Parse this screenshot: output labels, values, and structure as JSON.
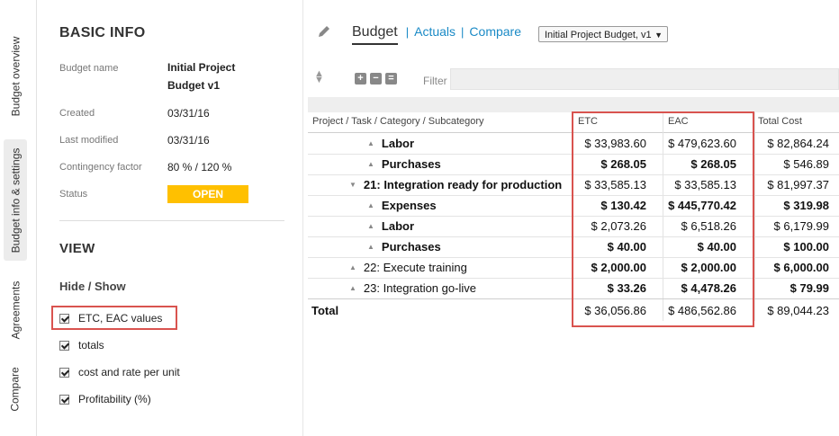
{
  "vertical_tabs": [
    {
      "label": "Budget overview"
    },
    {
      "label": "Budget info & settings"
    },
    {
      "label": "Agreements"
    },
    {
      "label": "Compare"
    }
  ],
  "basic_info": {
    "title": "BASIC INFO",
    "budget_name_label": "Budget name",
    "budget_name_line1": "Initial Project",
    "budget_name_line2": "Budget v1",
    "created_label": "Created",
    "created_value": "03/31/16",
    "modified_label": "Last modified",
    "modified_value": "03/31/16",
    "contingency_label": "Contingency factor",
    "contingency_value": "80 % / 120 %",
    "status_label": "Status",
    "status_value": "OPEN",
    "status_color": "#ffc000"
  },
  "view": {
    "title": "VIEW",
    "hide_show_label": "Hide / Show",
    "options": [
      {
        "label": "ETC, EAC values",
        "checked": true
      },
      {
        "label": "totals",
        "checked": true
      },
      {
        "label": "cost and rate per unit",
        "checked": true
      },
      {
        "label": "Profitability (%)",
        "checked": true
      }
    ]
  },
  "tabs": {
    "budget": "Budget",
    "actuals": "Actuals",
    "compare": "Compare",
    "separator": "|"
  },
  "version_select": "Initial Project Budget, v1",
  "toolbar": {
    "filter_label": "Filter",
    "expand_glyph": "+",
    "collapse_glyph": "−",
    "collapse_all_glyph": "="
  },
  "table": {
    "headers": {
      "name": "Project / Task / Category / Subcategory",
      "etc": "ETC",
      "eac": "EAC",
      "total": "Total Cost"
    },
    "rows": [
      {
        "name": "Labor",
        "tri": "▲",
        "etc": "$ 33,983.60",
        "eac": "$ 479,623.60",
        "total": "$ 82,864.24"
      },
      {
        "name": "Purchases",
        "tri": "▲",
        "etc": "$ 268.05",
        "eac": "$ 268.05",
        "total": "$ 546.89"
      },
      {
        "name": "21: Integration ready for production",
        "tri": "▼",
        "etc": "$ 33,585.13",
        "eac": "$ 33,585.13",
        "total": "$ 81,997.37"
      },
      {
        "name": "Expenses",
        "tri": "▲",
        "etc": "$ 130.42",
        "eac": "$ 445,770.42",
        "total": "$ 319.98"
      },
      {
        "name": "Labor",
        "tri": "▲",
        "etc": "$ 2,073.26",
        "eac": "$ 6,518.26",
        "total": "$ 6,179.99"
      },
      {
        "name": "Purchases",
        "tri": "▲",
        "etc": "$ 40.00",
        "eac": "$ 40.00",
        "total": "$ 100.00"
      },
      {
        "name": "22: Execute training",
        "tri": "▲",
        "etc": "$ 2,000.00",
        "eac": "$ 2,000.00",
        "total": "$ 6,000.00"
      },
      {
        "name": "23: Integration go-live",
        "tri": "▲",
        "etc": "$ 33.26",
        "eac": "$ 4,478.26",
        "total": "$ 79.99"
      }
    ],
    "total": {
      "label": "Total",
      "etc": "$ 36,056.86",
      "eac": "$ 486,562.86",
      "total": "$ 89,044.23"
    }
  },
  "highlight_color": "#d9534f"
}
